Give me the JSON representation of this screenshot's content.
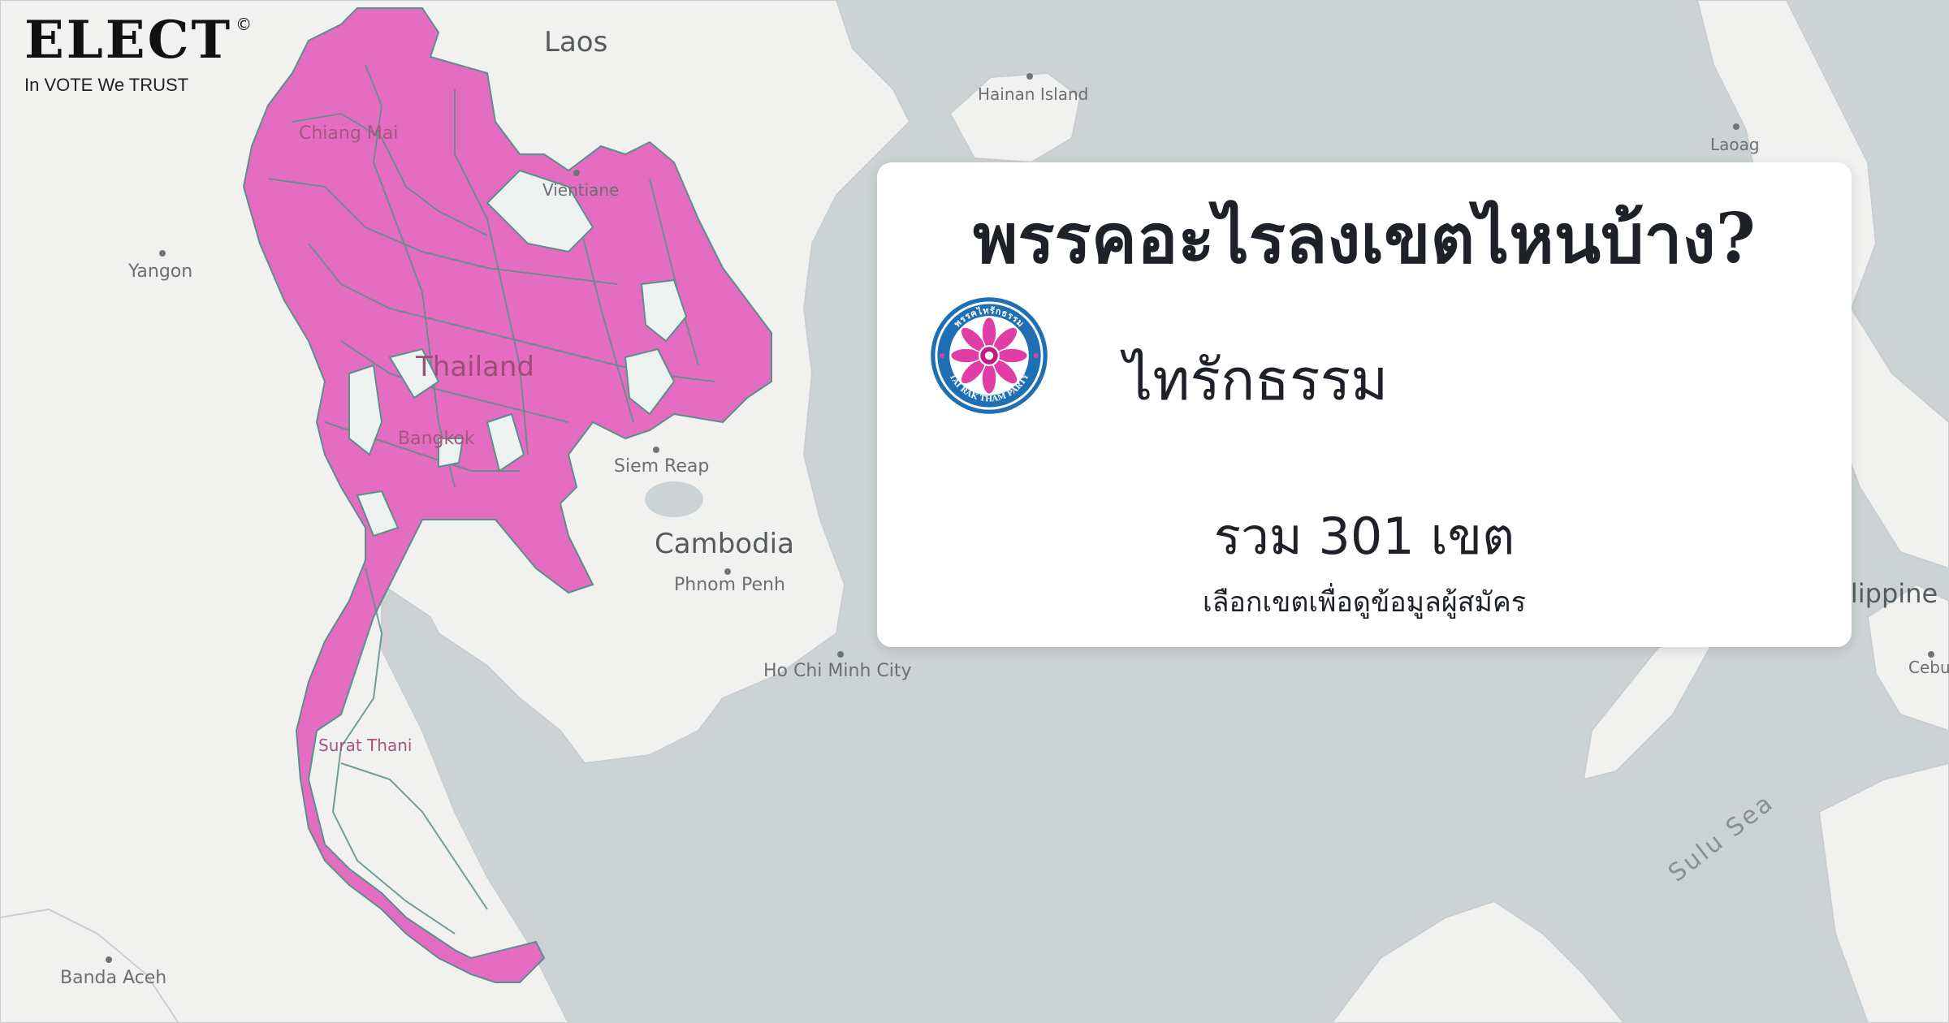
{
  "brand": {
    "logo": "ELECT",
    "copyright": "©",
    "tagline": "In VOTE We TRUST"
  },
  "card": {
    "title": "พรรคอะไรลงเขตไหนบ้าง?",
    "party_name": "ไทรักธรรม",
    "party_logo_text_top": "พรรคไทรักธรรม",
    "party_logo_text_bottom": "TAI RAK THAM PARTY",
    "total_label": "รวม 301 เขต",
    "hint": "เลือกเขตเพื่อดูข้อมูลผู้สมัคร"
  },
  "map": {
    "labels": {
      "laos": "Laos",
      "hainan": "Hainan Island",
      "laoag": "Laoag",
      "chiang_mai": "Chiang Mai",
      "vientiane": "Vientiane",
      "yangon": "Yangon",
      "thailand": "Thailand",
      "bangkok": "Bangkok",
      "siem_reap": "Siem Reap",
      "cambodia": "Cambodia",
      "phnom_penh": "Phnom Penh",
      "ho_chi_minh": "Ho Chi Minh City",
      "philippines_partial": "ilippine",
      "cebu": "Cebu",
      "surat_thani": "Surat Thani",
      "sulu_sea": "Sulu Sea",
      "banda_aceh": "Banda Aceh"
    },
    "colors": {
      "sea": "#cdd2d4",
      "land": "#f1f1f0",
      "contested_districts": "#e46cc1",
      "district_border": "#5b8f8a",
      "no_candidate": "#edf2f0"
    }
  }
}
